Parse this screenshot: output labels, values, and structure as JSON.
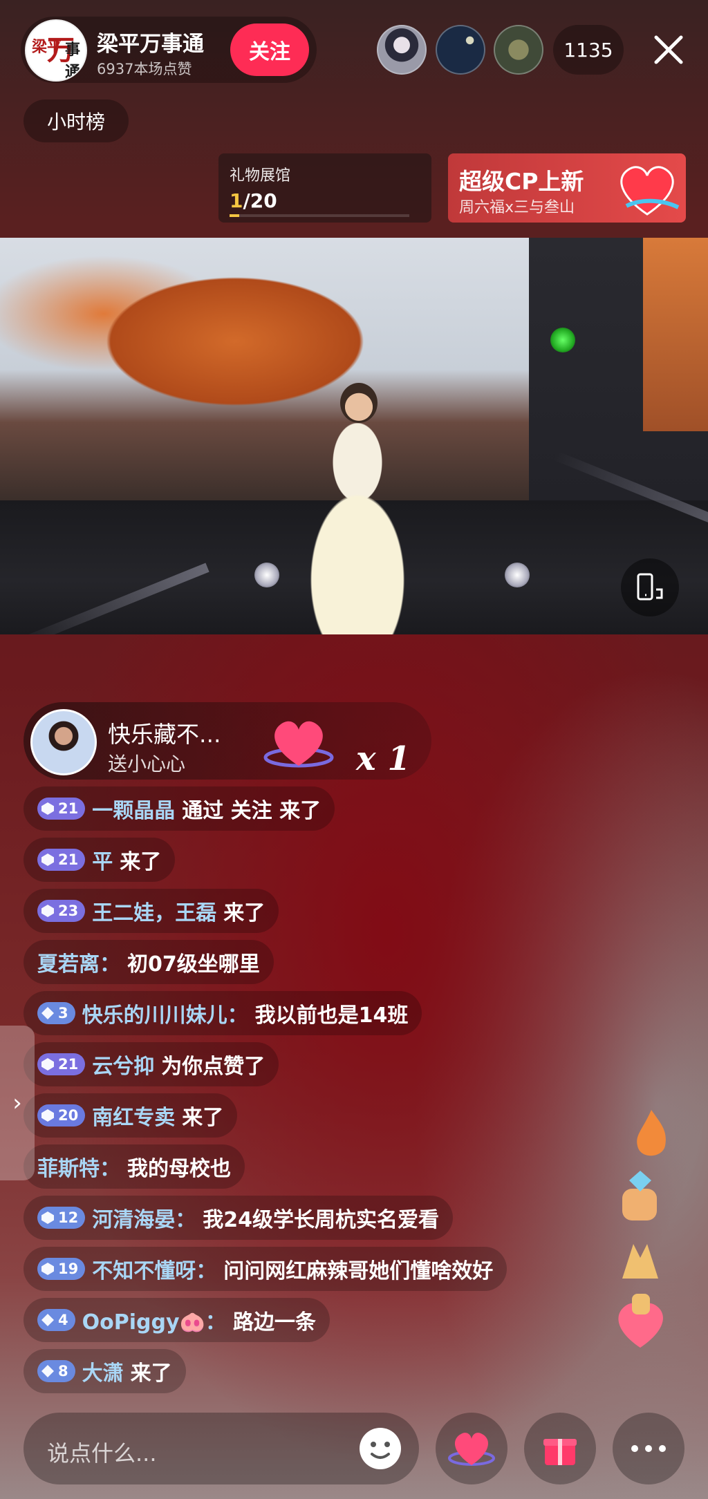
{
  "host": {
    "name": "梁平万事通",
    "likes_text": "6937本场点赞",
    "follow_label": "关注",
    "avatar_text": {
      "left": "梁平",
      "center": "万",
      "right": "事通"
    }
  },
  "viewers": {
    "count": "1135"
  },
  "hour_rank_label": "小时榜",
  "gift_hall": {
    "title": "礼物展馆",
    "progress_current": "1",
    "progress_total": "/20",
    "progress_fraction": 0.05
  },
  "cp_banner": {
    "title": "超级CP上新",
    "subtitle": "周六福x三与叁山"
  },
  "gift_notice": {
    "user": "快乐藏不...",
    "action": "送小心心",
    "count": "x 1"
  },
  "chat": [
    {
      "level": "21",
      "badge": "hex",
      "badge_color": "#7b6fe0",
      "user": "一颗晶晶",
      "text": "通过 关注 来了",
      "sep": false
    },
    {
      "level": "21",
      "badge": "hex",
      "badge_color": "#7b6fe0",
      "user": "平",
      "text": "来了",
      "sep": false
    },
    {
      "level": "23",
      "badge": "hex",
      "badge_color": "#7b6fe0",
      "user": "王二娃，王磊",
      "text": "来了",
      "sep": false
    },
    {
      "level": "",
      "badge": "",
      "badge_color": "",
      "user": "夏若离：",
      "text": "初07级坐哪里",
      "sep": false
    },
    {
      "level": "3",
      "badge": "diamond",
      "badge_color": "#6a8ae0",
      "user": "快乐的川川妹儿：",
      "text": "我以前也是14班",
      "sep": false
    },
    {
      "level": "21",
      "badge": "hex",
      "badge_color": "#7b6fe0",
      "user": "云兮抑",
      "text": "为你点赞了",
      "sep": false
    },
    {
      "level": "20",
      "badge": "hex",
      "badge_color": "#6a7ae0",
      "user": "南红专卖",
      "text": "来了",
      "sep": false
    },
    {
      "level": "",
      "badge": "",
      "badge_color": "",
      "user": "菲斯特：",
      "text": "我的母校也",
      "sep": false
    },
    {
      "level": "12",
      "badge": "hex",
      "badge_color": "#6a8ae0",
      "user": "河清海晏：",
      "text": "我24级学长周杭实名爱看",
      "sep": false
    },
    {
      "level": "19",
      "badge": "hex",
      "badge_color": "#6a8ae0",
      "user": "不知不懂呀：",
      "text": "问问网红麻辣哥她们懂啥效好",
      "sep": false
    },
    {
      "level": "4",
      "badge": "diamond",
      "badge_color": "#6a8ae0",
      "user": "OoPiggy🐽：",
      "text": "路边一条",
      "sep": false
    },
    {
      "level": "8",
      "badge": "diamond",
      "badge_color": "#6a8ae0",
      "user": "大潇",
      "text": "来了",
      "sep": false
    }
  ],
  "input": {
    "placeholder": "说点什么..."
  },
  "icons": {
    "close": "close-icon",
    "emoji": "emoji-icon",
    "heart_gift": "heart-gift-icon",
    "gift_box": "gift-box-icon",
    "more": "more-icon",
    "rotate": "rotate-screen-icon",
    "drawer": "chevron-right-icon"
  },
  "colors": {
    "follow": "#fe2c55",
    "progress": "#f5c542",
    "username": "#a9d6f5",
    "cp_banner": "#e44a4a"
  }
}
